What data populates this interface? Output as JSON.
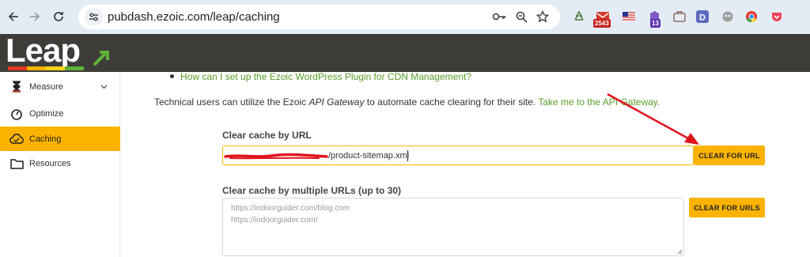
{
  "browser": {
    "url": "pubdash.ezoic.com/leap/caching",
    "back_icon": "arrow-left",
    "forward_icon": "arrow-right",
    "reload_icon": "reload",
    "extension_badges": {
      "mail": "2543",
      "calendar": "13"
    }
  },
  "app": {
    "logo_text": "Leap",
    "accent_color": "#fbb300",
    "header_color": "#3e3c38",
    "link_color": "#5a9e2b"
  },
  "sidebar": {
    "items": [
      {
        "label": "Measure",
        "icon": "hourglass-icon",
        "expandable": true
      },
      {
        "label": "Optimize",
        "icon": "gauge-icon"
      },
      {
        "label": "Caching",
        "icon": "cloud-icon",
        "active": true
      },
      {
        "label": "Resources",
        "icon": "folder-icon"
      }
    ]
  },
  "content": {
    "bullet_link": "How can I set up the Ezoic WordPress Plugin for CDN Management?",
    "para_prefix": "Technical users can utilize the Ezoic ",
    "para_em": "API Gateway",
    "para_middle": " to automate cache clearing for their site. ",
    "para_link": "Take me to the API Gateway.",
    "url_section": {
      "label": "Clear cache by URL",
      "value": "/product-sitemap.xml",
      "button": "CLEAR FOR URL"
    },
    "urls_section": {
      "label": "Clear cache by multiple URLs (up to 30)",
      "placeholder_lines": [
        "https://indoorguider.com/blog.com",
        "https://indoorguider.com/"
      ],
      "button": "CLEAR FOR URLS"
    }
  }
}
